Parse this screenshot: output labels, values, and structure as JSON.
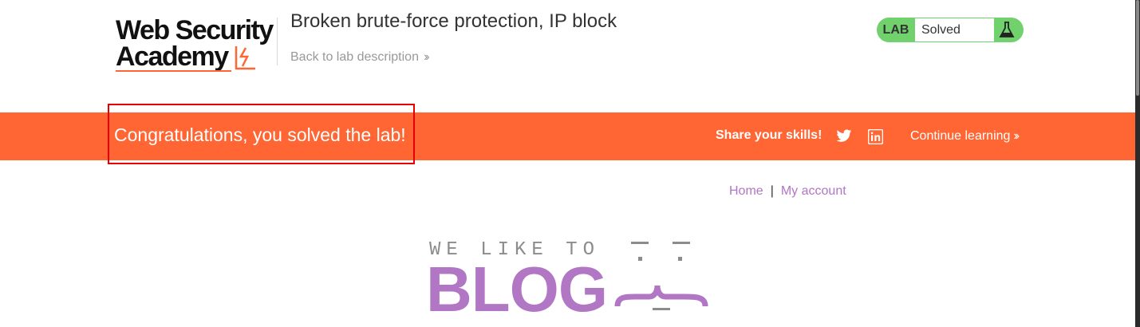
{
  "header": {
    "logo_line1": "Web Security",
    "logo_line2": "Academy",
    "lab_title": "Broken brute-force protection, IP block",
    "back_link": "Back to lab description",
    "lab_status": {
      "tag": "LAB",
      "state": "Solved"
    }
  },
  "banner": {
    "message": "Congratulations, you solved the lab!",
    "share_text": "Share your skills!",
    "continue_link": "Continue learning"
  },
  "nav": {
    "home": "Home",
    "separator": "|",
    "my_account": "My account"
  },
  "blog_logo": {
    "top": "WE LIKE TO",
    "main": "BLOG"
  },
  "colors": {
    "accent_orange": "#ff6633",
    "lab_green": "#70d16d",
    "link_purple": "#b176c4",
    "highlight_red": "#e80000"
  },
  "icons": [
    "lightning-bolt-icon",
    "flask-icon",
    "chevron-right-double-icon",
    "twitter-icon",
    "linkedin-icon"
  ]
}
